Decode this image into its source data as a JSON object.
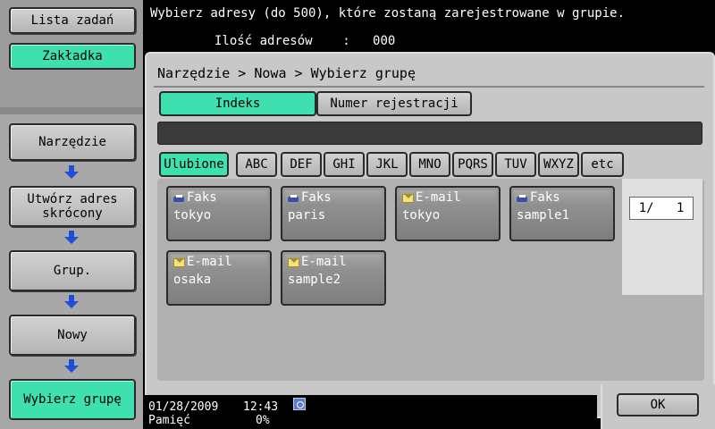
{
  "sidebar": {
    "lista_zadan": "Lista zadań",
    "zakladka": "Zakładka",
    "steps": [
      "Narzędzie",
      "Utwórz adres skrócony",
      "Grup.",
      "Nowy",
      "Wybierz grupę"
    ]
  },
  "header": {
    "message": "Wybierz adresy (do 500), które zostaną zarejestrowane w grupie.",
    "count_label": "Ilość adresów",
    "count_sep": ":",
    "count_value": "000"
  },
  "breadcrumb": "Narzędzie > Nowa > Wybierz grupę",
  "tabs": {
    "indeks": "Indeks",
    "numer": "Numer rejestracji"
  },
  "index_buttons": [
    "Ulubione",
    "ABC",
    "DEF",
    "GHI",
    "JKL",
    "MNO",
    "PQRS",
    "TUV",
    "WXYZ",
    "etc"
  ],
  "addresses": [
    {
      "type": "Faks",
      "name": "tokyo",
      "icon": "fax-icon"
    },
    {
      "type": "Faks",
      "name": "paris",
      "icon": "fax-icon"
    },
    {
      "type": "E-mail",
      "name": "tokyo",
      "icon": "email-icon"
    },
    {
      "type": "Faks",
      "name": "sample1",
      "icon": "fax-icon"
    },
    {
      "type": "E-mail",
      "name": "osaka",
      "icon": "email-icon"
    },
    {
      "type": "E-mail",
      "name": "sample2",
      "icon": "email-icon"
    }
  ],
  "pagination": "1/   1",
  "ok_label": "OK",
  "status": {
    "date": "01/28/2009",
    "time": "12:43",
    "memory_label": "Pamięć",
    "memory_value": "0%"
  },
  "colors": {
    "accent": "#3ee0b0",
    "arrow": "#1f4fd8"
  }
}
